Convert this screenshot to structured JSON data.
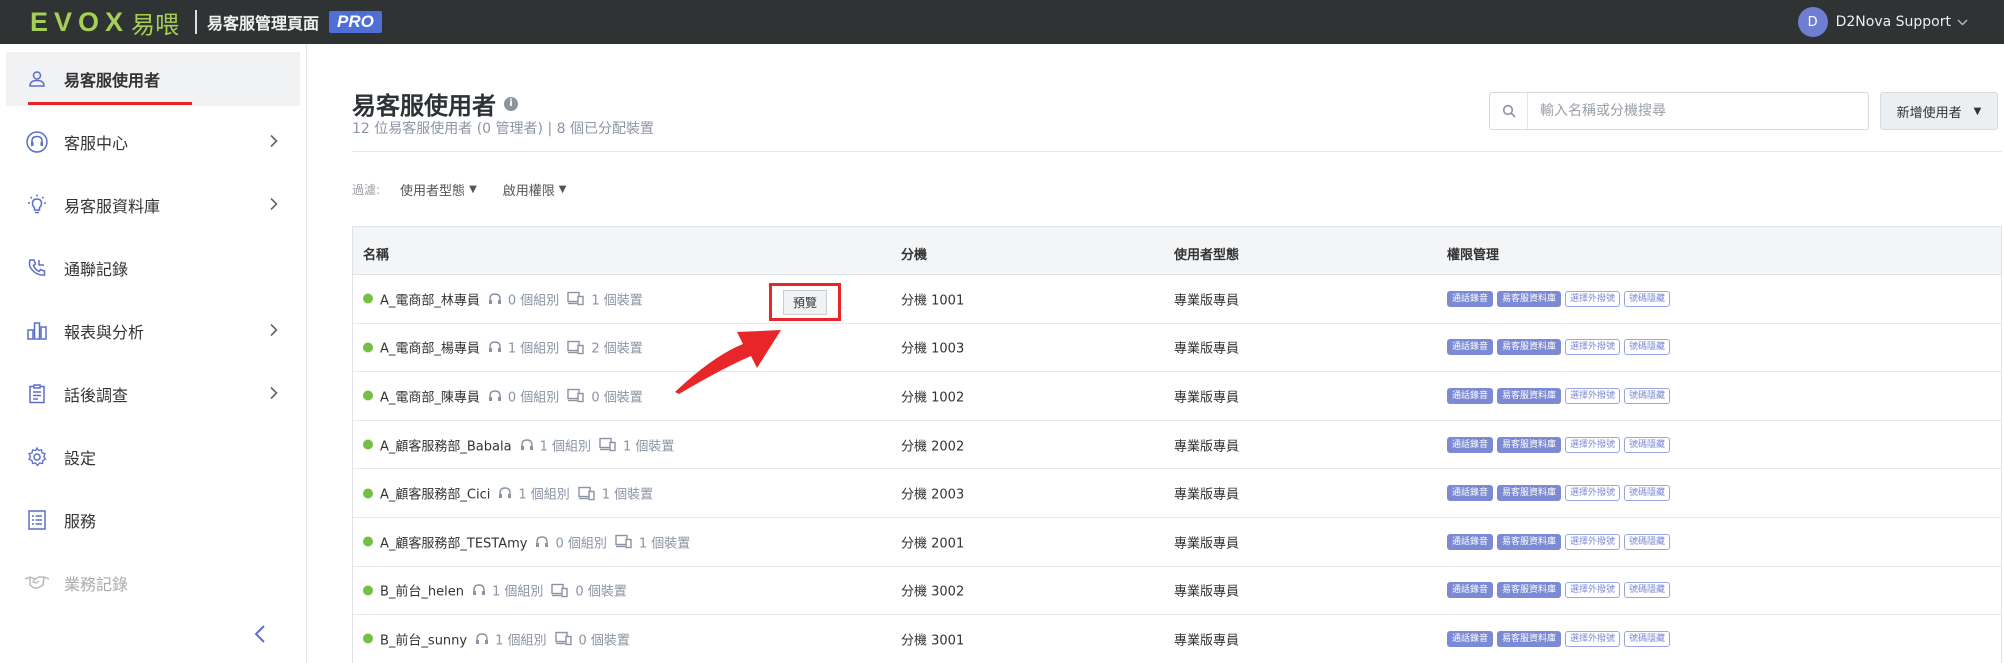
{
  "topbar": {
    "logo_text": "EVOX",
    "logo_cn": "易喂",
    "app_title": "易客服管理頁面",
    "pro_badge": "PRO",
    "user": {
      "initial": "D",
      "name": "D2Nova Support"
    }
  },
  "sidebar": {
    "items": [
      {
        "label": "易客服使用者",
        "icon": "user-icon",
        "active": true,
        "chevron": false
      },
      {
        "label": "客服中心",
        "icon": "headset-icon",
        "chevron": true
      },
      {
        "label": "易客服資料庫",
        "icon": "lightbulb-icon",
        "chevron": true
      },
      {
        "label": "通聯記錄",
        "icon": "phone-icon",
        "chevron": false
      },
      {
        "label": "報表與分析",
        "icon": "bar-chart-icon",
        "chevron": true
      },
      {
        "label": "話後調查",
        "icon": "clipboard-icon",
        "chevron": true
      },
      {
        "label": "設定",
        "icon": "gear-icon",
        "chevron": false
      },
      {
        "label": "服務",
        "icon": "list-icon",
        "chevron": false
      },
      {
        "label": "業務記錄",
        "icon": "handshake-icon",
        "chevron": false,
        "disabled": true
      }
    ]
  },
  "main": {
    "title": "易客服使用者",
    "subtitle": "12 位易客服使用者 (0 管理者) | 8 個已分配裝置",
    "search_placeholder": "輸入名稱或分機搜尋",
    "add_button": "新增使用者",
    "filters": {
      "label": "過濾:",
      "items": [
        "使用者型態",
        "啟用權限"
      ]
    },
    "table": {
      "columns": [
        "名稱",
        "分機",
        "使用者型態",
        "權限管理"
      ],
      "preview_label": "預覽",
      "tags": [
        "通話錄音",
        "易客服資料庫",
        "選擇外撥號",
        "號碼隱藏"
      ],
      "rows": [
        {
          "name": "A_電商部_林專員",
          "groups": "0 個組別",
          "devices": "1 個裝置",
          "ext": "分機 1001",
          "type": "專業版專員"
        },
        {
          "name": "A_電商部_楊專員",
          "groups": "1 個組別",
          "devices": "2 個裝置",
          "ext": "分機 1003",
          "type": "專業版專員"
        },
        {
          "name": "A_電商部_陳專員",
          "groups": "0 個組別",
          "devices": "0 個裝置",
          "ext": "分機 1002",
          "type": "專業版專員"
        },
        {
          "name": "A_顧客服務部_Babala",
          "groups": "1 個組別",
          "devices": "1 個裝置",
          "ext": "分機 2002",
          "type": "專業版專員"
        },
        {
          "name": "A_顧客服務部_Cici",
          "groups": "1 個組別",
          "devices": "1 個裝置",
          "ext": "分機 2003",
          "type": "專業版專員"
        },
        {
          "name": "A_顧客服務部_TESTAmy",
          "groups": "0 個組別",
          "devices": "1 個裝置",
          "ext": "分機 2001",
          "type": "專業版專員"
        },
        {
          "name": "B_前台_helen",
          "groups": "1 個組別",
          "devices": "0 個裝置",
          "ext": "分機 3002",
          "type": "專業版專員"
        },
        {
          "name": "B_前台_sunny",
          "groups": "1 個組別",
          "devices": "0 個裝置",
          "ext": "分機 3001",
          "type": "專業版專員"
        }
      ]
    }
  },
  "colors": {
    "topbar": "#2f3334",
    "brand_green": "#a6cf58",
    "accent_blue": "#4f6fd6",
    "highlight_red": "#e8262a",
    "status_green": "#74c043",
    "tag_blue": "#7c8ad4"
  }
}
